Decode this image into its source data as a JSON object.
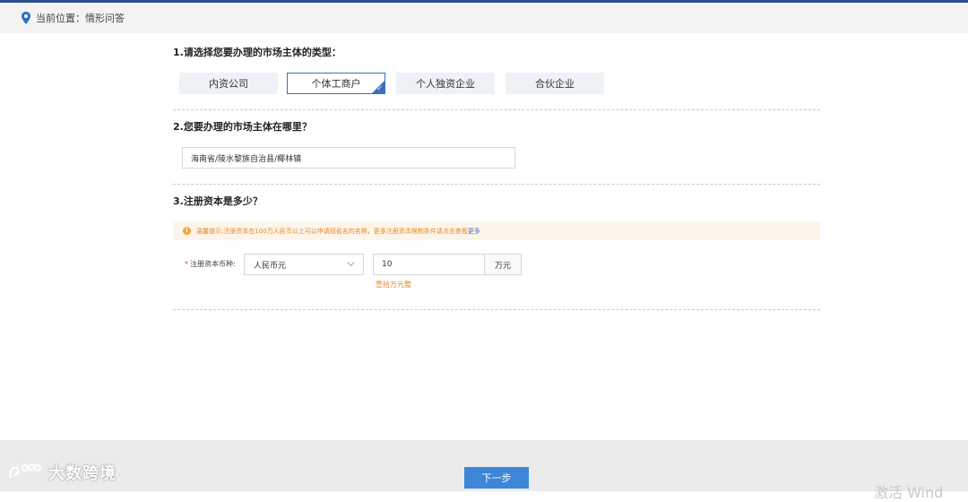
{
  "breadcrumb": {
    "text": "当前位置：情形问答"
  },
  "q1": {
    "title": "1.请选择您要办理的市场主体的类型：",
    "options": [
      {
        "label": "内资公司"
      },
      {
        "label": "个体工商户"
      },
      {
        "label": "个人独资企业"
      },
      {
        "label": "合伙企业"
      }
    ],
    "selected": "个体工商户"
  },
  "q2": {
    "title": "2.您要办理的市场主体在哪里？",
    "location_value": "海南省/陵水黎族自治县/椰林镇"
  },
  "q3": {
    "title": "3.注册资本是多少？",
    "notice": {
      "text": "温馨提示:注册资本在100万人民币以上可以申请冠省名的名称，更多注册资本限制条件请点击查看",
      "link": "更多"
    },
    "field_label": "注册资本币种:",
    "required_mark": "*",
    "currency": "人民币元",
    "amount": "10",
    "unit": "万元",
    "amount_caps": "壹拾万元整"
  },
  "footer": {
    "next_label": "下一步"
  },
  "watermark": {
    "text": "大数跨境"
  },
  "overlay": {
    "activate_text": "激活 Wind"
  },
  "colors": {
    "accent": "#3a6fc4",
    "button": "#3d86d8",
    "notice": "#e0882a",
    "header_line": "#2a4d8f"
  }
}
